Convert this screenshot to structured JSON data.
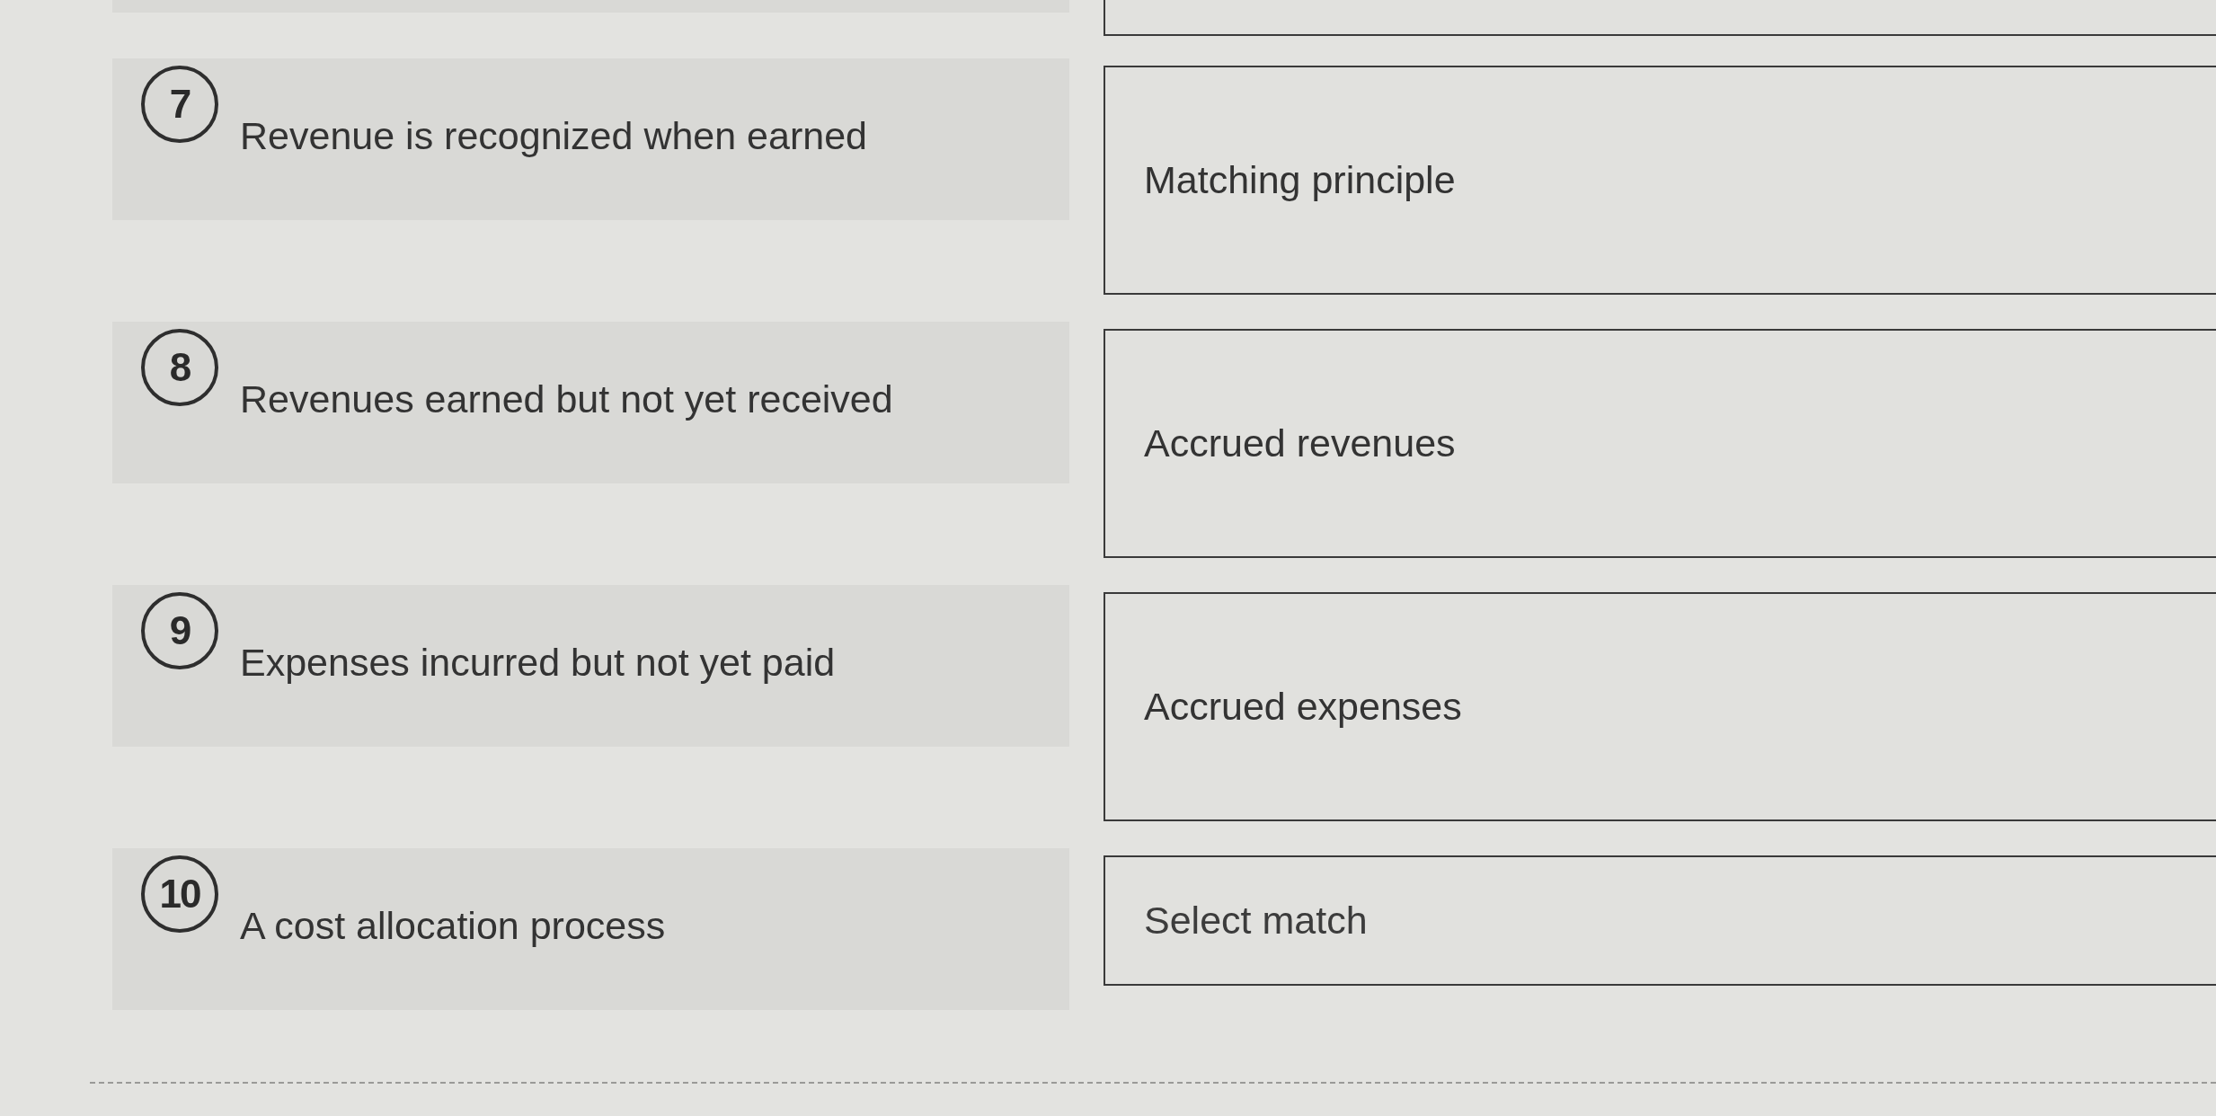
{
  "questions": [
    {
      "number": "7",
      "prompt": "Revenue is recognized when earned",
      "match": {
        "value": "Matching principle"
      }
    },
    {
      "number": "8",
      "prompt": "Revenues earned but not yet received",
      "match": {
        "value": "Accrued revenues"
      }
    },
    {
      "number": "9",
      "prompt": "Expenses incurred but not yet paid",
      "match": {
        "value": "Accrued expenses"
      }
    },
    {
      "number": "10",
      "prompt": "A cost allocation process",
      "match": {
        "placeholder": "Select match"
      }
    }
  ]
}
